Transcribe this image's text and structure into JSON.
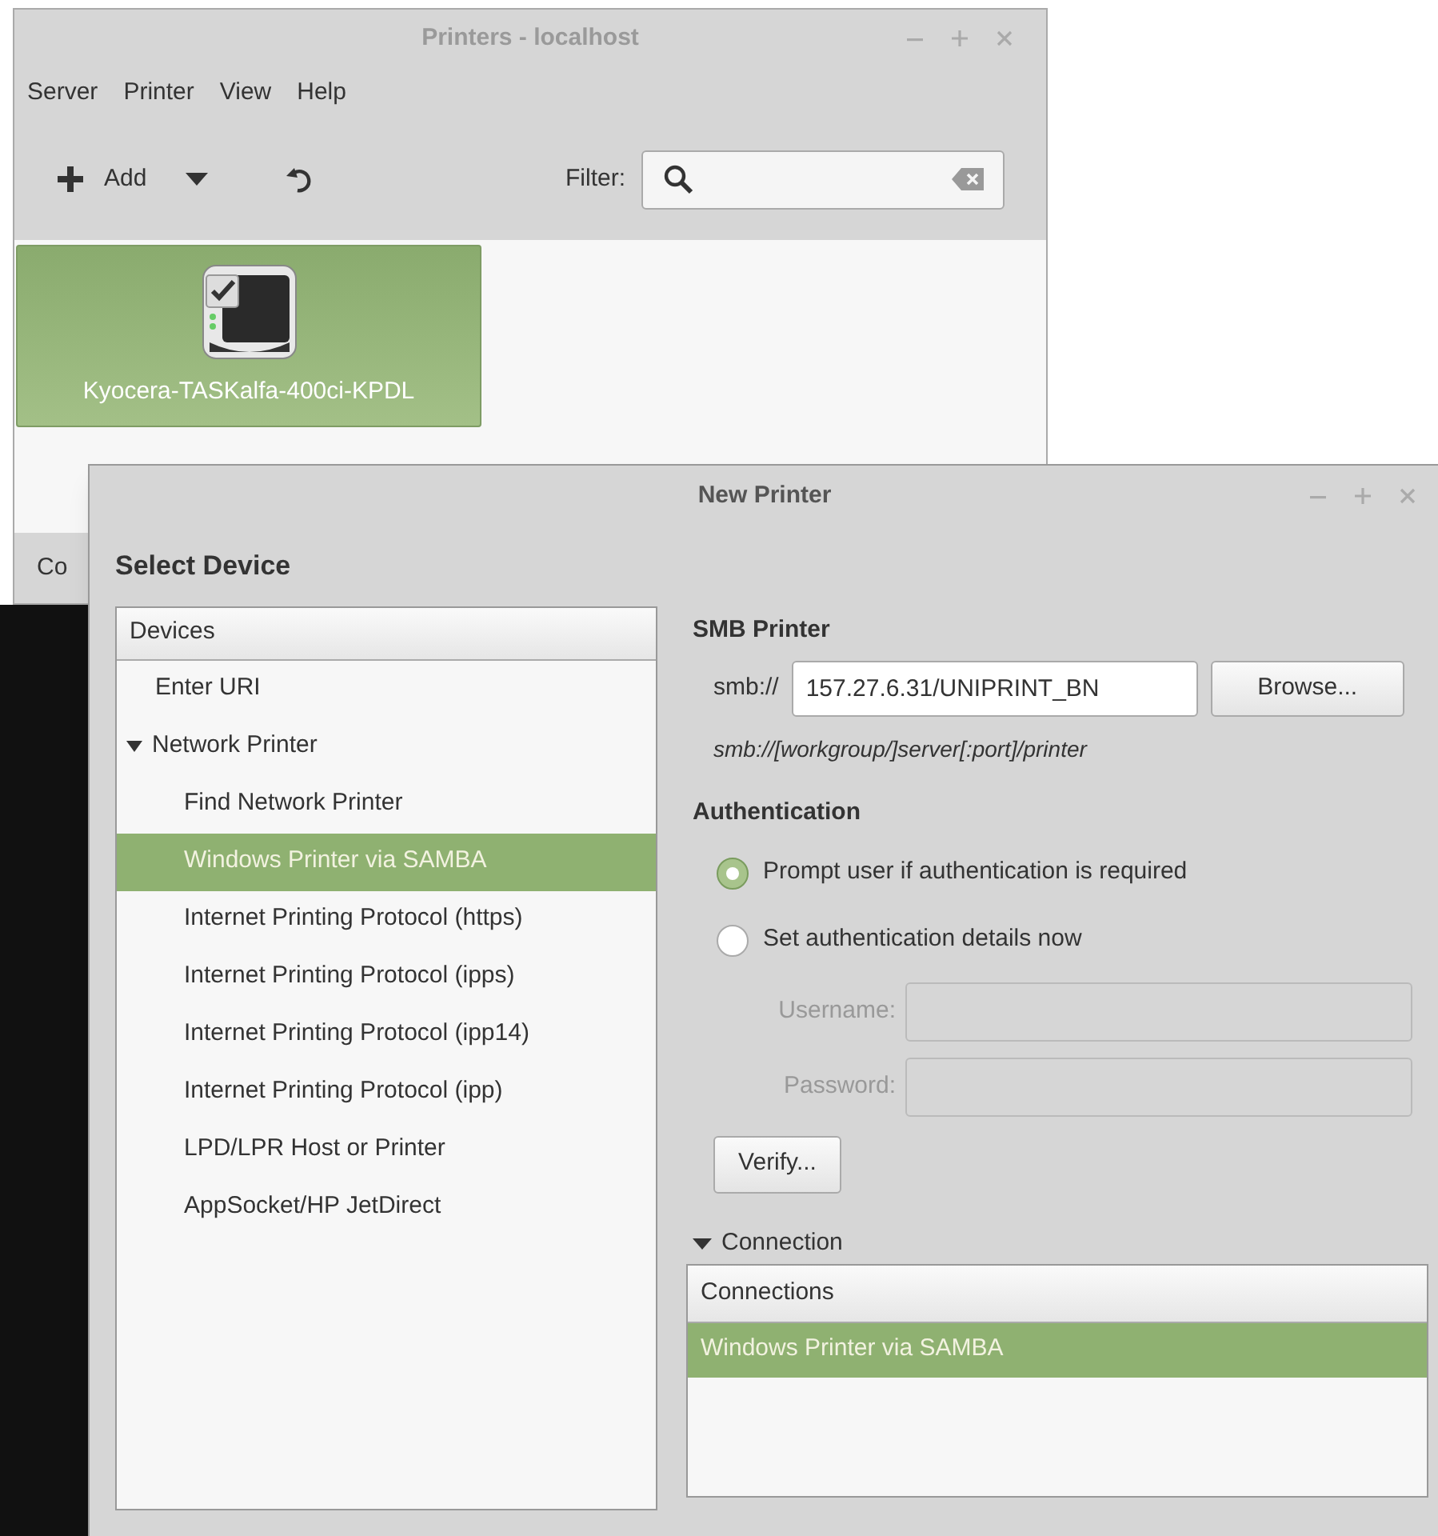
{
  "printers_window": {
    "title": "Printers - localhost",
    "menu": [
      "Server",
      "Printer",
      "View",
      "Help"
    ],
    "add_label": "Add",
    "filter_label": "Filter:",
    "printers": [
      {
        "name": "Kyocera-TASKalfa-400ci-KPDL",
        "selected": true
      }
    ],
    "status_text": "Co"
  },
  "new_printer_dialog": {
    "title": "New Printer",
    "heading": "Select Device",
    "devices_header": "Devices",
    "devices": [
      {
        "label": "Enter URI",
        "selected": false
      },
      {
        "label": "Network Printer",
        "selected": false,
        "expanded": true,
        "children": [
          {
            "label": "Find Network Printer",
            "selected": false
          },
          {
            "label": "Windows Printer via SAMBA",
            "selected": true
          },
          {
            "label": "Internet Printing Protocol (https)",
            "selected": false
          },
          {
            "label": "Internet Printing Protocol (ipps)",
            "selected": false
          },
          {
            "label": "Internet Printing Protocol (ipp14)",
            "selected": false
          },
          {
            "label": "Internet Printing Protocol (ipp)",
            "selected": false
          },
          {
            "label": "LPD/LPR Host or Printer",
            "selected": false
          },
          {
            "label": "AppSocket/HP JetDirect",
            "selected": false
          }
        ]
      }
    ],
    "smb": {
      "heading": "SMB Printer",
      "prefix": "smb://",
      "value": "157.27.6.31/UNIPRINT_BN",
      "browse": "Browse...",
      "hint": "smb://[workgroup/]server[:port]/printer"
    },
    "authentication": {
      "heading": "Authentication",
      "options": [
        {
          "label": "Prompt user if authentication is required",
          "selected": true
        },
        {
          "label": "Set authentication details now",
          "selected": false
        }
      ],
      "username_label": "Username:",
      "password_label": "Password:",
      "disabled": true,
      "verify": "Verify..."
    },
    "connection": {
      "label": "Connection",
      "expanded": true,
      "header": "Connections",
      "rows": [
        {
          "label": "Windows Printer via SAMBA",
          "selected": true
        }
      ]
    }
  }
}
